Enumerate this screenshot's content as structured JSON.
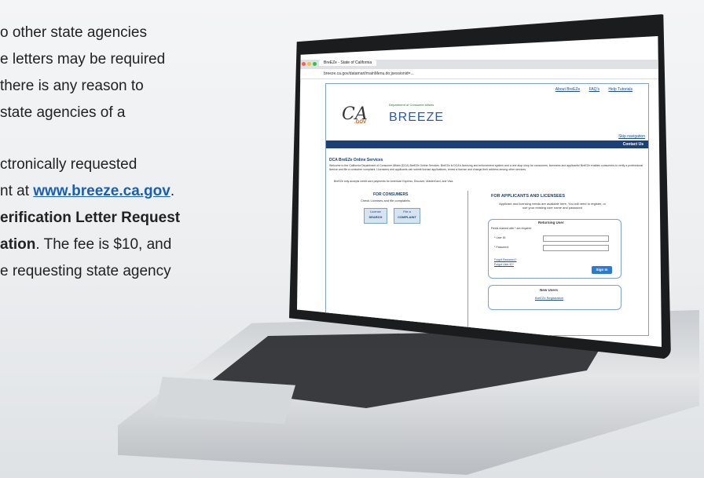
{
  "background_text": {
    "line1": "o other state agencies",
    "line2": "e letters may be required",
    "line3": "there is any reason to",
    "line4": "state agencies of a",
    "line5": "ctronically requested",
    "line6_prefix": "nt at ",
    "line6_link": "www.breeze.ca.gov",
    "line6_suffix": ".",
    "line7": "erification Letter Request",
    "line8_bold": "ation",
    "line8_rest": ". The fee is $10, and",
    "line9": "e requesting state agency"
  },
  "browser": {
    "tab_title": "BreEZe - State of California",
    "url": "breeze.ca.gov/datamart/mainMenu.do;jsessionid=..."
  },
  "site": {
    "nav": [
      "About BreEZe",
      "FAQ's",
      "Help Tutorials"
    ],
    "logo_ca": "CA",
    "logo_gov": ".GOV",
    "logo_dept": "Department of Consumer Affairs",
    "logo_breeze": "BREEZE",
    "skip_navigation": "Skip navigation",
    "contact_us": "Contact Us",
    "online_services_title": "DCA BreEZe Online Services",
    "welcome_text": "Welcome to the California Department of Consumer Affairs (DCA) BreEZe Online Services. BreEZe is DCA's licensing and enforcement system and a one-stop shop for consumers, licensees and applicants! BreEZe enables consumers to verify a professional license and file a consumer complaint. Licensees and applicants can submit license applications, renew a license and change their address among other services.",
    "payment_note": "BreEZe only accepts credit card payments for American Express, Discover, MasterCard, and Visa.",
    "consumers": {
      "title": "FOR CONSUMERS",
      "subtitle": "Check Licenses and file complaints.",
      "license_search_line1": "License",
      "license_search_line2": "SEARCH",
      "file_complaint_line1": "File a",
      "file_complaint_line2": "COMPLAINT"
    },
    "applicants": {
      "title": "FOR APPLICANTS AND LICENSEES",
      "subtitle": "Applicant and licensing needs are available here. You will need to register, or use your existing user name and password",
      "returning_user": "Returning User",
      "required_note": "Fields marked with * are required",
      "user_id_label": "* User ID:",
      "password_label": "* Password:",
      "forgot_password": "Forgot Password?",
      "forgot_user_id": "Forgot User ID?",
      "sign_in": "Sign In",
      "new_users": "New Users",
      "registration": "BreEZe Registration"
    }
  }
}
